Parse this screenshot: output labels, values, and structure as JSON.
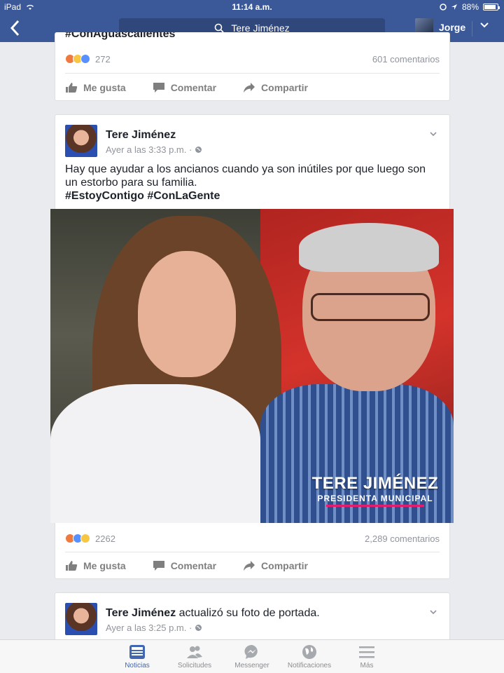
{
  "status": {
    "device": "iPad",
    "time": "11:14 a.m.",
    "battery": "88%",
    "battery_level": 0.88
  },
  "nav": {
    "search_text": "Tere Jiménez",
    "user_name": "Jorge"
  },
  "prev_post": {
    "clipped_text": "#ConAguascalientes",
    "reaction_count": "272",
    "comments": "601 comentarios"
  },
  "actions": {
    "like": "Me gusta",
    "comment": "Comentar",
    "share": "Compartir"
  },
  "post": {
    "author": "Tere Jiménez",
    "time": "Ayer a las 3:33 p.m. ·",
    "text": "Hay que ayudar a los ancianos cuando ya son inútiles por que luego son un estorbo para su familia.",
    "hashtags": "#EstoyContigo #ConLaGente",
    "photo_brand_name": "TERE JIMÉNEZ",
    "photo_brand_title": "PRESIDENTA MUNICIPAL",
    "reaction_count": "2262",
    "comments": "2,289 comentarios"
  },
  "next_post": {
    "author": "Tere Jiménez",
    "action": "actualizó su foto de portada.",
    "time": "Ayer a las 3:25 p.m. ·"
  },
  "tabbar": [
    {
      "label": "Noticias",
      "icon": "news-feed-icon"
    },
    {
      "label": "Solicitudes",
      "icon": "friend-requests-icon"
    },
    {
      "label": "Messenger",
      "icon": "messenger-icon"
    },
    {
      "label": "Notificaciones",
      "icon": "globe-icon"
    },
    {
      "label": "Más",
      "icon": "menu-icon"
    }
  ],
  "colors": {
    "brand_blue": "#3b5998",
    "active_tab": "#4267b2",
    "background": "#e9ebee"
  }
}
